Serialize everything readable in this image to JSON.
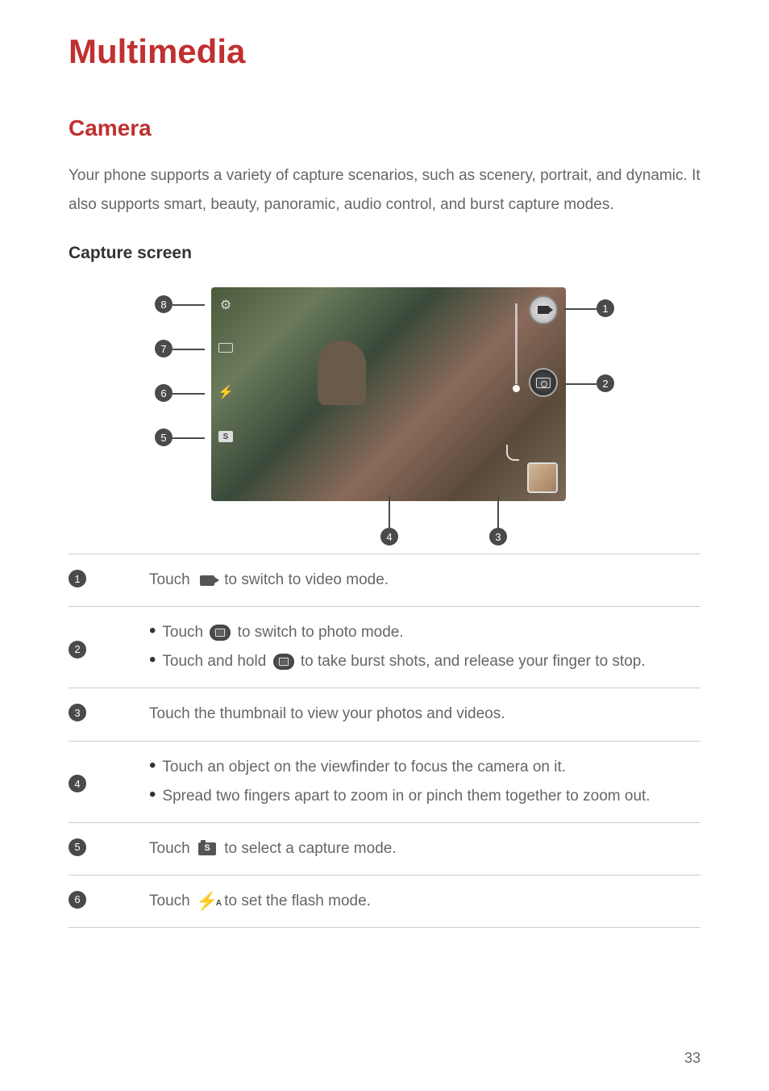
{
  "title": "Multimedia",
  "section": "Camera",
  "intro": "Your phone supports a variety of capture scenarios, such as scenery, portrait, and dynamic. It also supports smart, beauty, panoramic, audio control, and burst capture modes.",
  "subsection": "Capture  screen",
  "callouts": {
    "n1": "1",
    "n2": "2",
    "n3": "3",
    "n4": "4",
    "n5": "5",
    "n6": "6",
    "n7": "7",
    "n8": "8"
  },
  "rows": {
    "r1": {
      "num": "1",
      "text_before": "Touch ",
      "text_after": " to switch to video mode."
    },
    "r2": {
      "num": "2",
      "b1_before": "Touch ",
      "b1_after": " to switch to photo mode.",
      "b2_before": "Touch and hold ",
      "b2_after": " to take burst shots, and release your finger to stop."
    },
    "r3": {
      "num": "3",
      "text": "Touch the thumbnail to view your photos and videos."
    },
    "r4": {
      "num": "4",
      "b1": "Touch an object on the viewfinder to focus the camera on it.",
      "b2": "Spread two fingers apart to zoom in or pinch them together to zoom out."
    },
    "r5": {
      "num": "5",
      "text_before": "Touch ",
      "text_after": " to select a capture mode.",
      "icon_label": "S"
    },
    "r6": {
      "num": "6",
      "text_before": "Touch ",
      "text_after": " to set the flash mode."
    }
  },
  "page_number": "33"
}
